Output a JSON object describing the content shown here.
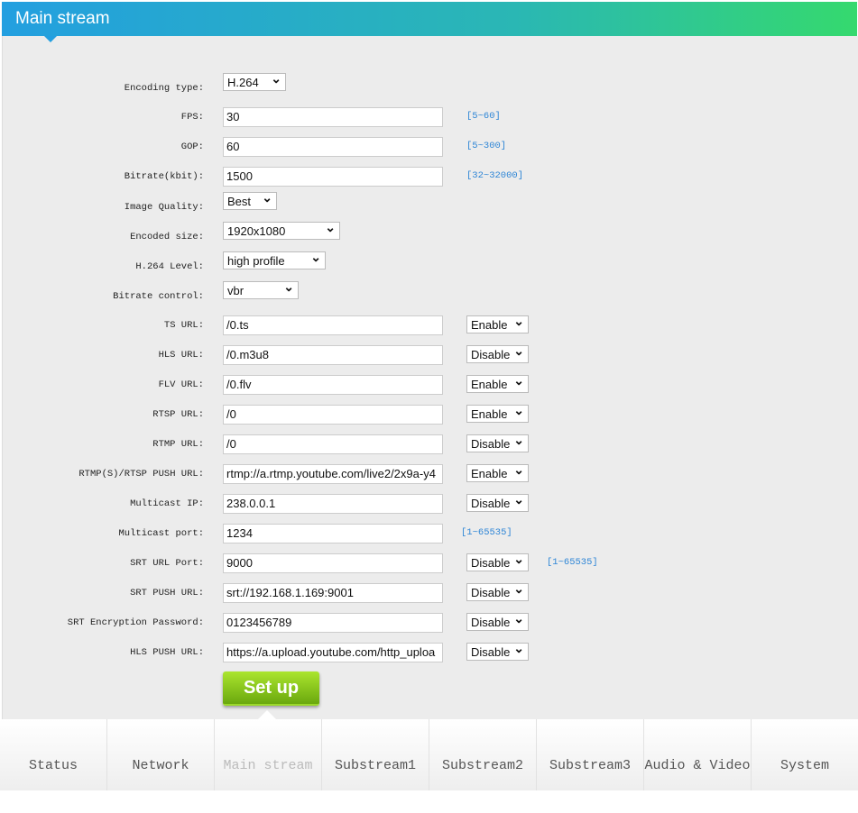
{
  "header": {
    "title": "Main stream"
  },
  "fields": [
    {
      "label": "Encoding type:",
      "select": "H.264"
    },
    {
      "label": "FPS:",
      "value": "30",
      "range": "[5~60]"
    },
    {
      "label": "GOP:",
      "value": "60",
      "range": "[5~300]"
    },
    {
      "label": "Bitrate(kbit):",
      "value": "1500",
      "range": "[32~32000]"
    },
    {
      "label": "Image Quality:",
      "select": "Best"
    },
    {
      "label": "Encoded size:",
      "select": "1920x1080"
    },
    {
      "label": "H.264 Level:",
      "select": "high profile"
    },
    {
      "label": "Bitrate control:",
      "select": "vbr"
    },
    {
      "label": "TS URL:",
      "value": "/0.ts",
      "toggle": "Enable"
    },
    {
      "label": "HLS URL:",
      "value": "/0.m3u8",
      "toggle": "Disable"
    },
    {
      "label": "FLV URL:",
      "value": "/0.flv",
      "toggle": "Enable"
    },
    {
      "label": "RTSP URL:",
      "value": "/0",
      "toggle": "Enable"
    },
    {
      "label": "RTMP URL:",
      "value": "/0",
      "toggle": "Disable"
    },
    {
      "label": "RTMP(S)/RTSP PUSH URL:",
      "value": "rtmp://a.rtmp.youtube.com/live2/2x9a-y4",
      "toggle": "Enable"
    },
    {
      "label": "Multicast IP:",
      "value": "238.0.0.1",
      "toggle": "Disable"
    },
    {
      "label": "Multicast port:",
      "value": "1234",
      "range": "[1~65535]"
    },
    {
      "label": "SRT URL Port:",
      "value": "9000",
      "toggle": "Disable",
      "range": "[1~65535]"
    },
    {
      "label": "SRT PUSH URL:",
      "value": "srt://192.168.1.169:9001",
      "toggle": "Disable"
    },
    {
      "label": "SRT Encryption Password:",
      "value": "0123456789",
      "toggle": "Disable"
    },
    {
      "label": "HLS PUSH URL:",
      "value": "https://a.upload.youtube.com/http_uploa",
      "toggle": "Disable"
    }
  ],
  "setup_label": "Set up",
  "nav": [
    "Status",
    "Network",
    "Main stream",
    "Substream1",
    "Substream2",
    "Substream3",
    "Audio & Video",
    "System"
  ],
  "active_nav": "Main stream"
}
